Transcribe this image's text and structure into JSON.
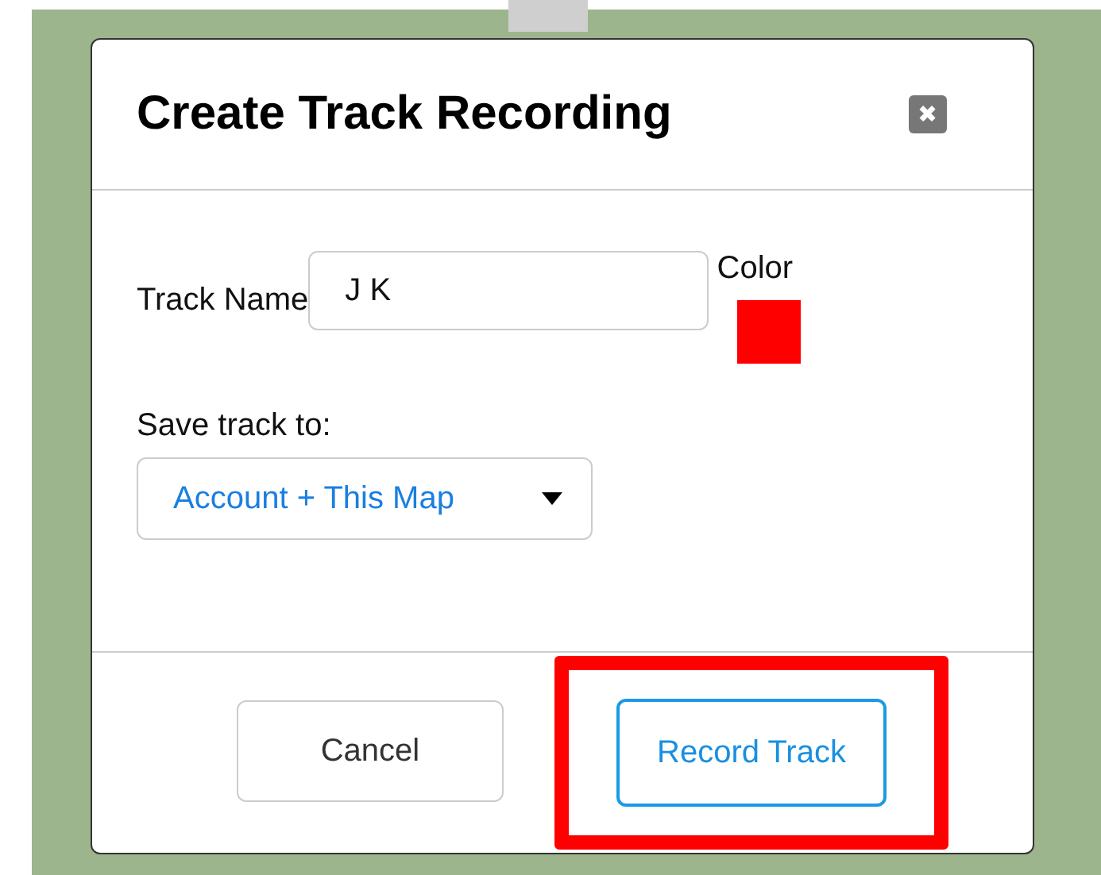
{
  "dialog": {
    "title": "Create Track Recording",
    "close_icon": "✖"
  },
  "track_name": {
    "label": "Track Name",
    "value": "J K"
  },
  "color": {
    "label": "Color",
    "color": "#ff0000"
  },
  "save_to": {
    "label": "Save track to:",
    "value": "Account + This Map"
  },
  "buttons": [
    {
      "label": "Cancel",
      "kind": "secondary",
      "highlighted": false
    },
    {
      "label": "Record Track",
      "kind": "primary",
      "highlighted": true
    }
  ]
}
